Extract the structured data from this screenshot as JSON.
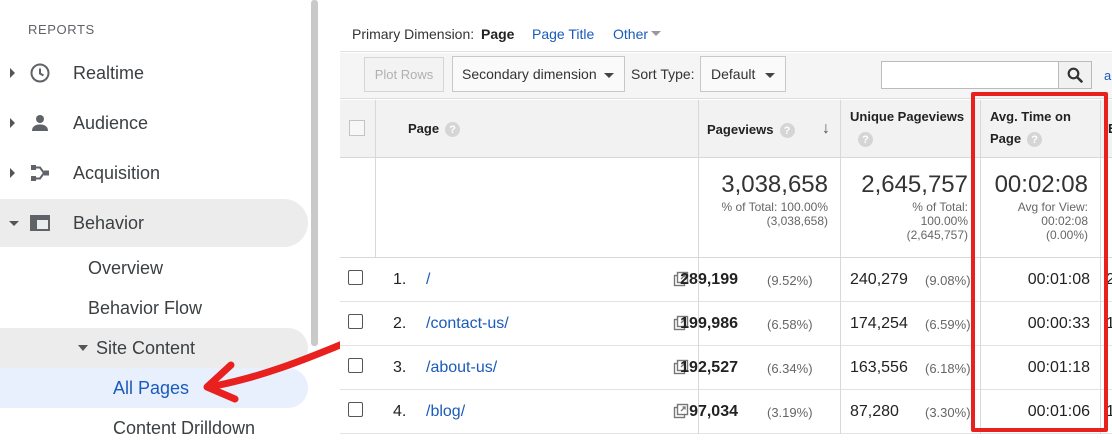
{
  "sidebar": {
    "heading": "REPORTS",
    "items": [
      {
        "label": "Realtime",
        "icon": "clock-icon"
      },
      {
        "label": "Audience",
        "icon": "person-icon"
      },
      {
        "label": "Acquisition",
        "icon": "acquisition-icon"
      },
      {
        "label": "Behavior",
        "icon": "behavior-icon"
      }
    ],
    "behavior_sub": {
      "overview": "Overview",
      "behavior_flow": "Behavior Flow",
      "site_content": "Site Content",
      "all_pages": "All Pages",
      "content_drilldown": "Content Drilldown"
    }
  },
  "dimension_bar": {
    "label": "Primary Dimension:",
    "selected": "Page",
    "page_title": "Page Title",
    "other": "Other"
  },
  "toolbar": {
    "plot_rows": "Plot Rows",
    "secondary_dimension": "Secondary dimension",
    "sort_type_label": "Sort Type:",
    "sort_type_value": "Default",
    "search_value": "",
    "advanced": "a"
  },
  "table": {
    "headers": {
      "page": "Page",
      "pageviews": "Pageviews",
      "unique_pageviews": "Unique Pageviews",
      "avg_time_line1": "Avg. Time on",
      "avg_time_line2": "Page",
      "extra": "E"
    },
    "totals": {
      "pageviews": "3,038,658",
      "pageviews_sub1": "% of Total: 100.00%",
      "pageviews_sub2": "(3,038,658)",
      "unique": "2,645,757",
      "unique_sub1": "% of Total:",
      "unique_sub2": "100.00%",
      "unique_sub3": "(2,645,757)",
      "avg": "00:02:08",
      "avg_sub1": "Avg for View:",
      "avg_sub2": "00:02:08",
      "avg_sub3": "(0.00%)"
    },
    "rows": [
      {
        "num": "1.",
        "page": "/",
        "pageviews": "289,199",
        "pv_pct": "(9.52%)",
        "unique": "240,279",
        "u_pct": "(9.08%)",
        "avg": "00:01:08",
        "extra": "2"
      },
      {
        "num": "2.",
        "page": "/contact-us/",
        "pageviews": "199,986",
        "pv_pct": "(6.58%)",
        "unique": "174,254",
        "u_pct": "(6.59%)",
        "avg": "00:00:33",
        "extra": "1"
      },
      {
        "num": "3.",
        "page": "/about-us/",
        "pageviews": "192,527",
        "pv_pct": "(6.34%)",
        "unique": "163,556",
        "u_pct": "(6.18%)",
        "avg": "00:01:18",
        "extra": ""
      },
      {
        "num": "4.",
        "page": "/blog/",
        "pageviews": "97,034",
        "pv_pct": "(3.19%)",
        "unique": "87,280",
        "u_pct": "(3.30%)",
        "avg": "00:01:06",
        "extra": "1"
      }
    ]
  },
  "colors": {
    "link": "#1a5bbb",
    "highlight": "#e8201e",
    "active_bg": "#e8f0fe"
  }
}
